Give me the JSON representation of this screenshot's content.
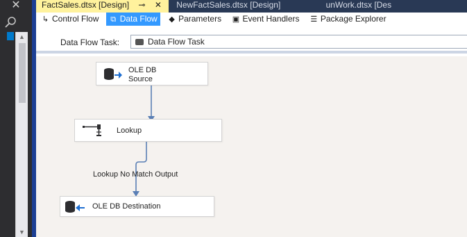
{
  "doc_tabs": [
    {
      "label": "FactSales.dtsx [Design]",
      "pin": "⊸",
      "close": "✕",
      "active": true
    },
    {
      "label": "NewFactSales.dtsx [Design]",
      "active": false
    },
    {
      "label": "unWork.dtsx [Des",
      "active": false
    }
  ],
  "designer_tabs": [
    {
      "label": "Control Flow",
      "icon": "control-flow-icon",
      "glyph": "↳"
    },
    {
      "label": "Data Flow",
      "icon": "data-flow-icon",
      "glyph": "⧉",
      "active": true
    },
    {
      "label": "Parameters",
      "icon": "parameters-icon",
      "glyph": "◆"
    },
    {
      "label": "Event Handlers",
      "icon": "event-handlers-icon",
      "glyph": "▣"
    },
    {
      "label": "Package Explorer",
      "icon": "package-explorer-icon",
      "glyph": "☰"
    }
  ],
  "task_bar": {
    "label": "Data Flow Task:",
    "selected": "Data Flow Task"
  },
  "canvas": {
    "nodes": {
      "source": {
        "line1": "OLE DB",
        "line2": "Source"
      },
      "lookup": {
        "label": "Lookup"
      },
      "destination": {
        "label": "OLE DB Destination"
      }
    },
    "path_label": "Lookup No Match Output"
  },
  "colors": {
    "accent": "#3399ff",
    "tab_active": "#fff29d",
    "connector": "#5a7fb5",
    "canvas": "#f5f2ef"
  }
}
